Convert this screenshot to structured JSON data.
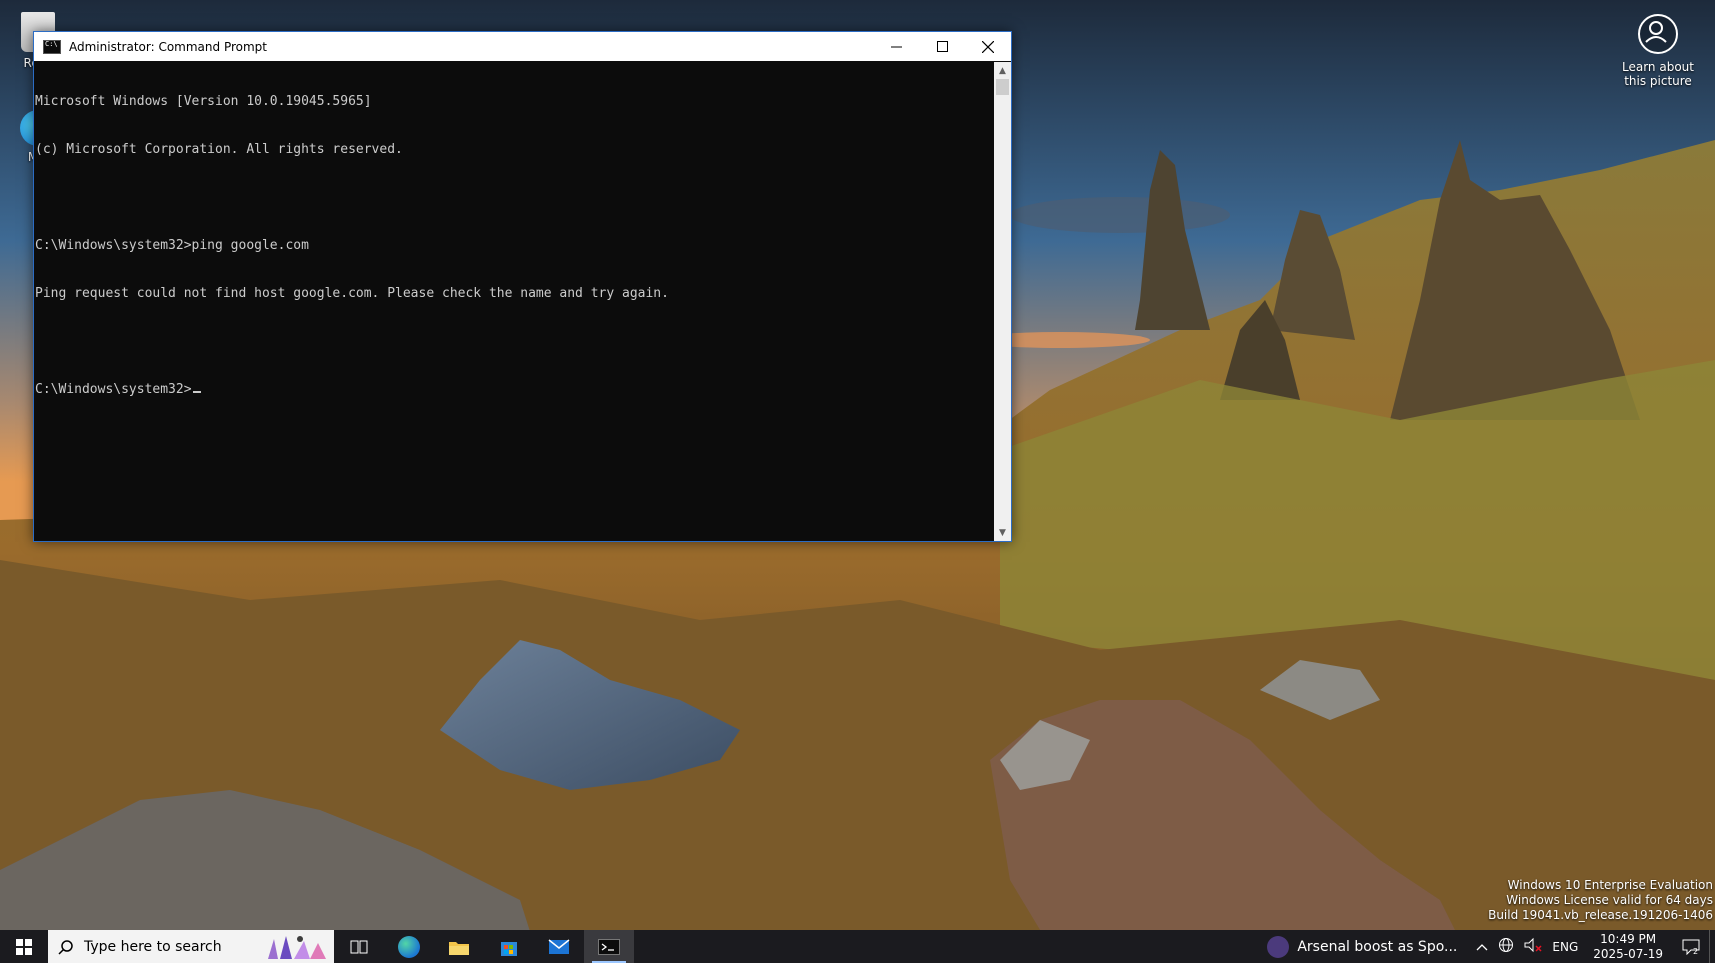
{
  "window": {
    "title": "Administrator: Command Prompt",
    "console_lines": [
      "Microsoft Windows [Version 10.0.19045.5965]",
      "(c) Microsoft Corporation. All rights reserved.",
      "",
      "C:\\Windows\\system32>ping google.com",
      "Ping request could not find host google.com. Please check the name and try again.",
      "",
      "C:\\Windows\\system32>"
    ]
  },
  "desktop": {
    "icons": [
      {
        "label": "Recy",
        "icon": "recycle-bin-icon"
      },
      {
        "label": "Mic\nE",
        "icon": "edge-icon"
      }
    ],
    "learn_label": "Learn about\nthis picture"
  },
  "watermark": {
    "line1": "Windows 10 Enterprise Evaluation",
    "line2": "Windows License valid for 64 days",
    "line3": "Build 19041.vb_release.191206-1406"
  },
  "taskbar": {
    "search_placeholder": "Type here to search",
    "apps": [
      "task-view-icon",
      "edge-icon",
      "file-explorer-icon",
      "store-icon",
      "mail-icon",
      "command-prompt-icon"
    ],
    "weather_text": "Arsenal boost as Spo...",
    "language": "ENG",
    "time": "10:49 PM",
    "date": "2025-07-19"
  },
  "colors": {
    "console_bg": "#0c0c0c",
    "console_fg": "#cccccc",
    "taskbar_bg": "#1b1b1f"
  }
}
